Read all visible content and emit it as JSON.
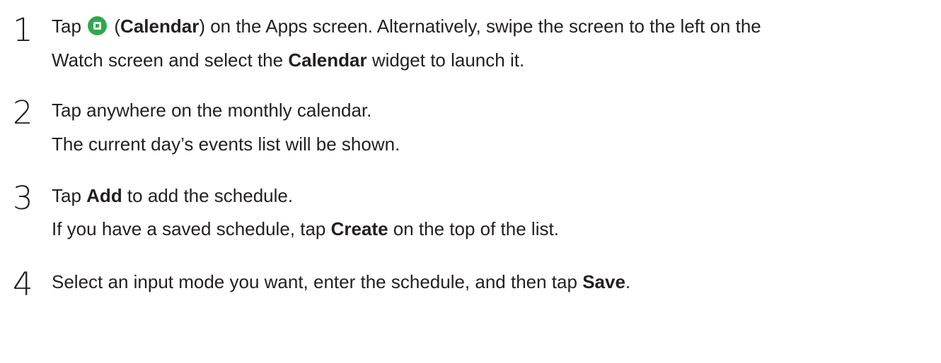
{
  "steps": [
    {
      "number": "1",
      "line1": {
        "t1": "Tap ",
        "icon": "calendar-app-icon",
        "t2": " (",
        "b1": "Calendar",
        "t3": ") on the Apps screen. Alternatively, swipe the screen to the left on the"
      },
      "line2": {
        "t1": "Watch screen and select the ",
        "b1": "Calendar",
        "t2": " widget to launch it."
      }
    },
    {
      "number": "2",
      "line1": "Tap anywhere on the monthly calendar.",
      "line2": "The current day’s events list will be shown."
    },
    {
      "number": "3",
      "line1": {
        "t1": "Tap ",
        "b1": "Add",
        "t2": " to add the schedule."
      },
      "line2": {
        "t1": "If you have a saved schedule, tap ",
        "b1": "Create",
        "t2": " on the top of the list."
      }
    },
    {
      "number": "4",
      "line1": {
        "t1": "Select an input mode you want, enter the schedule, and then tap ",
        "b1": "Save",
        "t2": "."
      }
    }
  ],
  "colors": {
    "text": "#231f20",
    "icon_green": "#2fa84c"
  }
}
